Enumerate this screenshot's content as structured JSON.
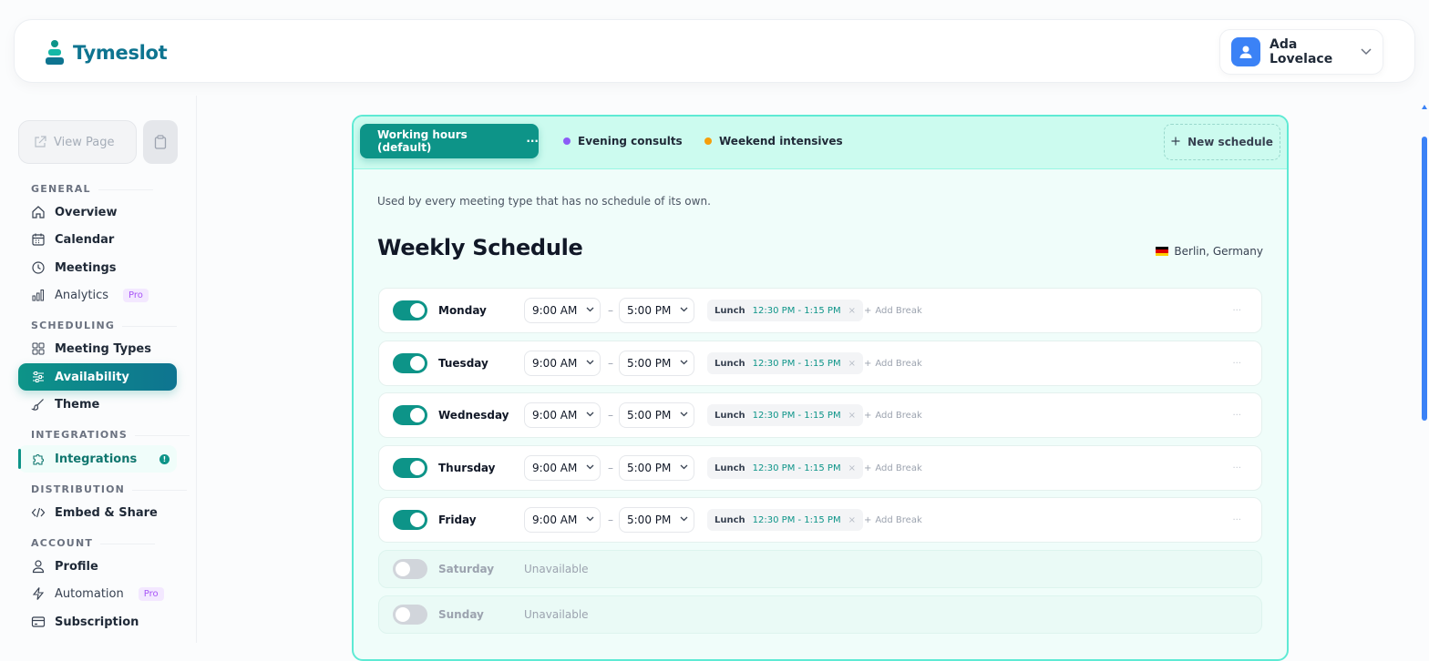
{
  "app": {
    "name": "Tymeslot"
  },
  "user": {
    "name": "Ada Lovelace"
  },
  "sidebar": {
    "view_page": "View Page",
    "sections": {
      "general": "GENERAL",
      "scheduling": "SCHEDULING",
      "integrations": "INTEGRATIONS",
      "distribution": "DISTRIBUTION",
      "account": "ACCOUNT"
    },
    "items": {
      "overview": "Overview",
      "calendar": "Calendar",
      "meetings": "Meetings",
      "analytics": "Analytics",
      "meeting_types": "Meeting Types",
      "availability": "Availability",
      "theme": "Theme",
      "integrations": "Integrations",
      "embed_share": "Embed & Share",
      "profile": "Profile",
      "automation": "Automation",
      "subscription": "Subscription"
    },
    "pro_badge": "Pro",
    "integrations_badge": "!"
  },
  "tabs": {
    "active": "Working hours (default)",
    "active_more": "···",
    "evening": "Evening consults",
    "weekend": "Weekend intensives",
    "new_schedule": "New schedule",
    "colors": {
      "evening": "#8b5cf6",
      "weekend": "#f59e0b"
    }
  },
  "schedule": {
    "description": "Used by every meeting type that has no schedule of its own.",
    "title": "Weekly Schedule",
    "timezone": "Berlin, Germany",
    "days": [
      {
        "name": "Monday",
        "enabled": true,
        "start": "9:00 AM",
        "end": "5:00 PM",
        "break_label": "Lunch",
        "break_time": "12:30 PM - 1:15 PM"
      },
      {
        "name": "Tuesday",
        "enabled": true,
        "start": "9:00 AM",
        "end": "5:00 PM",
        "break_label": "Lunch",
        "break_time": "12:30 PM - 1:15 PM"
      },
      {
        "name": "Wednesday",
        "enabled": true,
        "start": "9:00 AM",
        "end": "5:00 PM",
        "break_label": "Lunch",
        "break_time": "12:30 PM - 1:15 PM"
      },
      {
        "name": "Thursday",
        "enabled": true,
        "start": "9:00 AM",
        "end": "5:00 PM",
        "break_label": "Lunch",
        "break_time": "12:30 PM - 1:15 PM"
      },
      {
        "name": "Friday",
        "enabled": true,
        "start": "9:00 AM",
        "end": "5:00 PM",
        "break_label": "Lunch",
        "break_time": "12:30 PM - 1:15 PM"
      },
      {
        "name": "Saturday",
        "enabled": false,
        "status": "Unavailable"
      },
      {
        "name": "Sunday",
        "enabled": false,
        "status": "Unavailable"
      }
    ],
    "add_break": "Add Break",
    "separator": "–",
    "row_more": "···",
    "remove": "×"
  }
}
